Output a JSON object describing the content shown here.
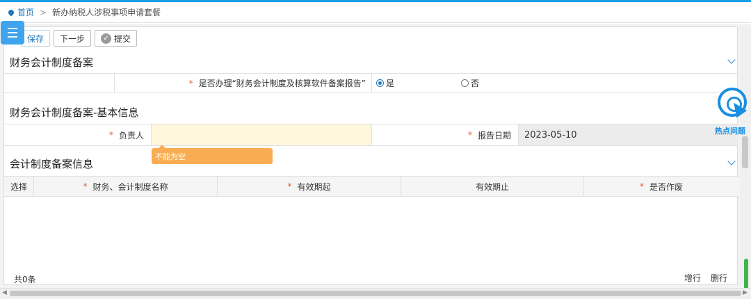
{
  "breadcrumb": {
    "home": "首页",
    "separator": ">",
    "current": "新办纳税人涉税事项申请套餐"
  },
  "toolbar": {
    "save": "保存",
    "next": "下一步",
    "submit": "提交"
  },
  "section1": {
    "title": "财务会计制度备案",
    "question": "是否办理“财务会计制度及核算软件备案报告”",
    "option_yes": "是",
    "option_no": "否",
    "selected": "是"
  },
  "section2": {
    "title": "财务会计制度备案-基本信息",
    "responsible_label": "负责人",
    "responsible_value": "",
    "report_date_label": "报告日期",
    "report_date_value": "2023-05-10",
    "error_tip": "不能为空"
  },
  "section3": {
    "title": "会计制度备案信息",
    "columns": [
      "选择",
      "财务、会计制度名称",
      "有效期起",
      "有效期止",
      "是否作废"
    ],
    "required_columns": [
      "财务、会计制度名称",
      "有效期起",
      "是否作废"
    ],
    "total": "共0条",
    "add_row": "增行",
    "delete_row": "删行"
  },
  "hotspot": {
    "label": "热点问题"
  },
  "required_mark": "*",
  "colors": {
    "accent": "#1a78c2",
    "required": "#e55a2e",
    "tooltip": "#f9ad52",
    "field_highlight": "#fef7dc"
  }
}
